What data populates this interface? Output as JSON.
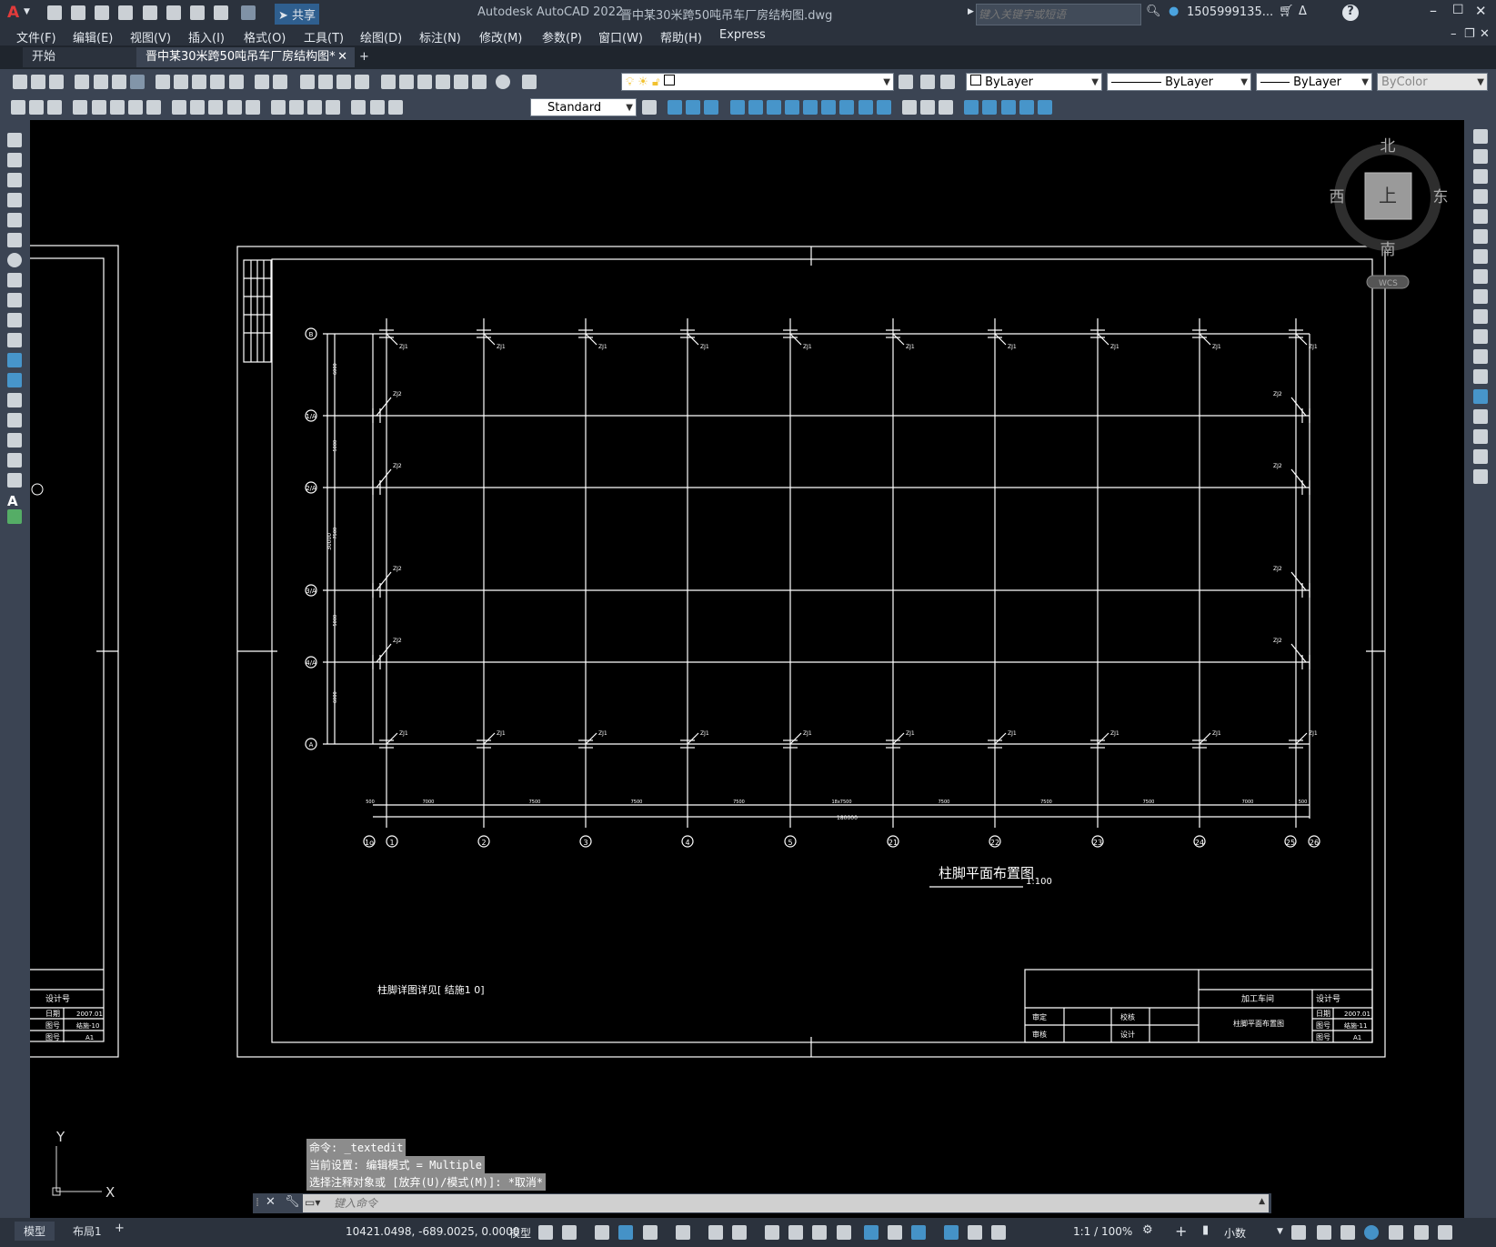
{
  "app": {
    "title": "Autodesk AutoCAD 2022",
    "filename": "晋中某30米跨50吨吊车厂房结构图.dwg",
    "share_label": "共享",
    "search_placeholder": "键入关键字或短语",
    "user": "1505999135..."
  },
  "menu": [
    "文件(F)",
    "编辑(E)",
    "视图(V)",
    "插入(I)",
    "格式(O)",
    "工具(T)",
    "绘图(D)",
    "标注(N)",
    "修改(M)",
    "参数(P)",
    "窗口(W)",
    "帮助(H)",
    "Express"
  ],
  "tabs": {
    "start": "开始",
    "active": "晋中某30米跨50吨吊车厂房结构图*",
    "add": "+"
  },
  "props": {
    "layer": "",
    "color": "ByLayer",
    "linetype": "ByLayer",
    "lineweight": "ByLayer",
    "plotstyle": "ByColor",
    "textstyle": "Standard"
  },
  "viewcube": {
    "north": "北",
    "south": "南",
    "east": "东",
    "west": "西",
    "top": "上",
    "wcs": "WCS"
  },
  "drawing": {
    "title": "柱脚平面布置图",
    "scale": "1:100",
    "detail_note": "柱脚详图详见[ 结施1 0]",
    "col_labels_left": [
      "B",
      "1/A",
      "2/A",
      "3/A",
      "4/A",
      "A"
    ],
    "col_labels_bottom": [
      "1o",
      "1",
      "2",
      "3",
      "4",
      "5",
      "21",
      "22",
      "23",
      "24",
      "25",
      "26"
    ],
    "dim_total": "180000",
    "dim_segments": [
      "500",
      "7000",
      "7500",
      "7500",
      "7500",
      "18x7500",
      "7500",
      "7500",
      "7500",
      "7000",
      "500"
    ],
    "left_dims": [
      "6000",
      "5000",
      "7500",
      "5000",
      "6000"
    ],
    "left_total": "30000",
    "zj1": "ZJ1",
    "zj2": "ZJ2",
    "title_block": {
      "company": "加工车间",
      "design_no": "设计号",
      "drawing_name": "柱脚平面布置图",
      "date_label": "日期",
      "date": "2007.01",
      "no_label": "图号",
      "no": "结施-11",
      "size_label": "图号",
      "size": "A1",
      "review": "审定",
      "check": "校核",
      "audit": "审核",
      "design": "设计"
    },
    "left_title_block": {
      "design_no": "设计号",
      "date_label": "日期",
      "date": "2007.01",
      "no_label": "图号",
      "no": "结施-10",
      "size_label": "图号",
      "size": "A1"
    }
  },
  "command": {
    "history": [
      "命令: _textedit",
      "当前设置: 编辑模式 = Multiple",
      "选择注释对象或 [放弃(U)/模式(M)]: *取消*"
    ],
    "placeholder": "键入命令"
  },
  "status": {
    "model_tab": "模型",
    "layout_tab": "布局1",
    "add": "+",
    "coords": "10421.0498, -689.0025, 0.0000",
    "model": "模型",
    "scale": "1:1 / 100%",
    "units": "小数"
  },
  "ucs": {
    "x": "X",
    "y": "Y"
  }
}
